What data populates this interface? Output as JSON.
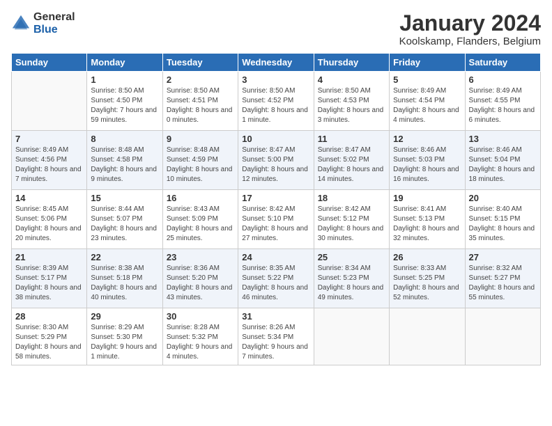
{
  "logo": {
    "general": "General",
    "blue": "Blue"
  },
  "title": "January 2024",
  "location": "Koolskamp, Flanders, Belgium",
  "days_of_week": [
    "Sunday",
    "Monday",
    "Tuesday",
    "Wednesday",
    "Thursday",
    "Friday",
    "Saturday"
  ],
  "weeks": [
    [
      {
        "day": "",
        "sunrise": "",
        "sunset": "",
        "daylight": ""
      },
      {
        "day": "1",
        "sunrise": "Sunrise: 8:50 AM",
        "sunset": "Sunset: 4:50 PM",
        "daylight": "Daylight: 7 hours and 59 minutes."
      },
      {
        "day": "2",
        "sunrise": "Sunrise: 8:50 AM",
        "sunset": "Sunset: 4:51 PM",
        "daylight": "Daylight: 8 hours and 0 minutes."
      },
      {
        "day": "3",
        "sunrise": "Sunrise: 8:50 AM",
        "sunset": "Sunset: 4:52 PM",
        "daylight": "Daylight: 8 hours and 1 minute."
      },
      {
        "day": "4",
        "sunrise": "Sunrise: 8:50 AM",
        "sunset": "Sunset: 4:53 PM",
        "daylight": "Daylight: 8 hours and 3 minutes."
      },
      {
        "day": "5",
        "sunrise": "Sunrise: 8:49 AM",
        "sunset": "Sunset: 4:54 PM",
        "daylight": "Daylight: 8 hours and 4 minutes."
      },
      {
        "day": "6",
        "sunrise": "Sunrise: 8:49 AM",
        "sunset": "Sunset: 4:55 PM",
        "daylight": "Daylight: 8 hours and 6 minutes."
      }
    ],
    [
      {
        "day": "7",
        "sunrise": "Sunrise: 8:49 AM",
        "sunset": "Sunset: 4:56 PM",
        "daylight": "Daylight: 8 hours and 7 minutes."
      },
      {
        "day": "8",
        "sunrise": "Sunrise: 8:48 AM",
        "sunset": "Sunset: 4:58 PM",
        "daylight": "Daylight: 8 hours and 9 minutes."
      },
      {
        "day": "9",
        "sunrise": "Sunrise: 8:48 AM",
        "sunset": "Sunset: 4:59 PM",
        "daylight": "Daylight: 8 hours and 10 minutes."
      },
      {
        "day": "10",
        "sunrise": "Sunrise: 8:47 AM",
        "sunset": "Sunset: 5:00 PM",
        "daylight": "Daylight: 8 hours and 12 minutes."
      },
      {
        "day": "11",
        "sunrise": "Sunrise: 8:47 AM",
        "sunset": "Sunset: 5:02 PM",
        "daylight": "Daylight: 8 hours and 14 minutes."
      },
      {
        "day": "12",
        "sunrise": "Sunrise: 8:46 AM",
        "sunset": "Sunset: 5:03 PM",
        "daylight": "Daylight: 8 hours and 16 minutes."
      },
      {
        "day": "13",
        "sunrise": "Sunrise: 8:46 AM",
        "sunset": "Sunset: 5:04 PM",
        "daylight": "Daylight: 8 hours and 18 minutes."
      }
    ],
    [
      {
        "day": "14",
        "sunrise": "Sunrise: 8:45 AM",
        "sunset": "Sunset: 5:06 PM",
        "daylight": "Daylight: 8 hours and 20 minutes."
      },
      {
        "day": "15",
        "sunrise": "Sunrise: 8:44 AM",
        "sunset": "Sunset: 5:07 PM",
        "daylight": "Daylight: 8 hours and 23 minutes."
      },
      {
        "day": "16",
        "sunrise": "Sunrise: 8:43 AM",
        "sunset": "Sunset: 5:09 PM",
        "daylight": "Daylight: 8 hours and 25 minutes."
      },
      {
        "day": "17",
        "sunrise": "Sunrise: 8:42 AM",
        "sunset": "Sunset: 5:10 PM",
        "daylight": "Daylight: 8 hours and 27 minutes."
      },
      {
        "day": "18",
        "sunrise": "Sunrise: 8:42 AM",
        "sunset": "Sunset: 5:12 PM",
        "daylight": "Daylight: 8 hours and 30 minutes."
      },
      {
        "day": "19",
        "sunrise": "Sunrise: 8:41 AM",
        "sunset": "Sunset: 5:13 PM",
        "daylight": "Daylight: 8 hours and 32 minutes."
      },
      {
        "day": "20",
        "sunrise": "Sunrise: 8:40 AM",
        "sunset": "Sunset: 5:15 PM",
        "daylight": "Daylight: 8 hours and 35 minutes."
      }
    ],
    [
      {
        "day": "21",
        "sunrise": "Sunrise: 8:39 AM",
        "sunset": "Sunset: 5:17 PM",
        "daylight": "Daylight: 8 hours and 38 minutes."
      },
      {
        "day": "22",
        "sunrise": "Sunrise: 8:38 AM",
        "sunset": "Sunset: 5:18 PM",
        "daylight": "Daylight: 8 hours and 40 minutes."
      },
      {
        "day": "23",
        "sunrise": "Sunrise: 8:36 AM",
        "sunset": "Sunset: 5:20 PM",
        "daylight": "Daylight: 8 hours and 43 minutes."
      },
      {
        "day": "24",
        "sunrise": "Sunrise: 8:35 AM",
        "sunset": "Sunset: 5:22 PM",
        "daylight": "Daylight: 8 hours and 46 minutes."
      },
      {
        "day": "25",
        "sunrise": "Sunrise: 8:34 AM",
        "sunset": "Sunset: 5:23 PM",
        "daylight": "Daylight: 8 hours and 49 minutes."
      },
      {
        "day": "26",
        "sunrise": "Sunrise: 8:33 AM",
        "sunset": "Sunset: 5:25 PM",
        "daylight": "Daylight: 8 hours and 52 minutes."
      },
      {
        "day": "27",
        "sunrise": "Sunrise: 8:32 AM",
        "sunset": "Sunset: 5:27 PM",
        "daylight": "Daylight: 8 hours and 55 minutes."
      }
    ],
    [
      {
        "day": "28",
        "sunrise": "Sunrise: 8:30 AM",
        "sunset": "Sunset: 5:29 PM",
        "daylight": "Daylight: 8 hours and 58 minutes."
      },
      {
        "day": "29",
        "sunrise": "Sunrise: 8:29 AM",
        "sunset": "Sunset: 5:30 PM",
        "daylight": "Daylight: 9 hours and 1 minute."
      },
      {
        "day": "30",
        "sunrise": "Sunrise: 8:28 AM",
        "sunset": "Sunset: 5:32 PM",
        "daylight": "Daylight: 9 hours and 4 minutes."
      },
      {
        "day": "31",
        "sunrise": "Sunrise: 8:26 AM",
        "sunset": "Sunset: 5:34 PM",
        "daylight": "Daylight: 9 hours and 7 minutes."
      },
      {
        "day": "",
        "sunrise": "",
        "sunset": "",
        "daylight": ""
      },
      {
        "day": "",
        "sunrise": "",
        "sunset": "",
        "daylight": ""
      },
      {
        "day": "",
        "sunrise": "",
        "sunset": "",
        "daylight": ""
      }
    ]
  ]
}
